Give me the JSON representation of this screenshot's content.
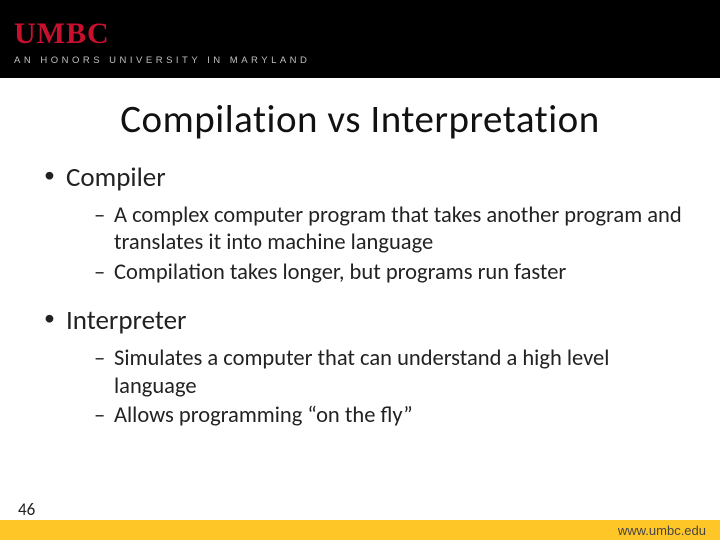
{
  "header": {
    "logo": "UMBC",
    "tagline": "AN HONORS UNIVERSITY IN MARYLAND"
  },
  "title": "Compilation vs Interpretation",
  "bullets": [
    {
      "label": "Compiler",
      "sub": [
        "A complex computer program that takes another program and translates it into machine language",
        "Compilation takes longer, but programs run faster"
      ]
    },
    {
      "label": "Interpreter",
      "sub": [
        "Simulates a computer that can understand a high level language",
        "Allows programming “on the fly”"
      ]
    }
  ],
  "footer": {
    "page": "46",
    "url": "www.umbc.edu"
  }
}
